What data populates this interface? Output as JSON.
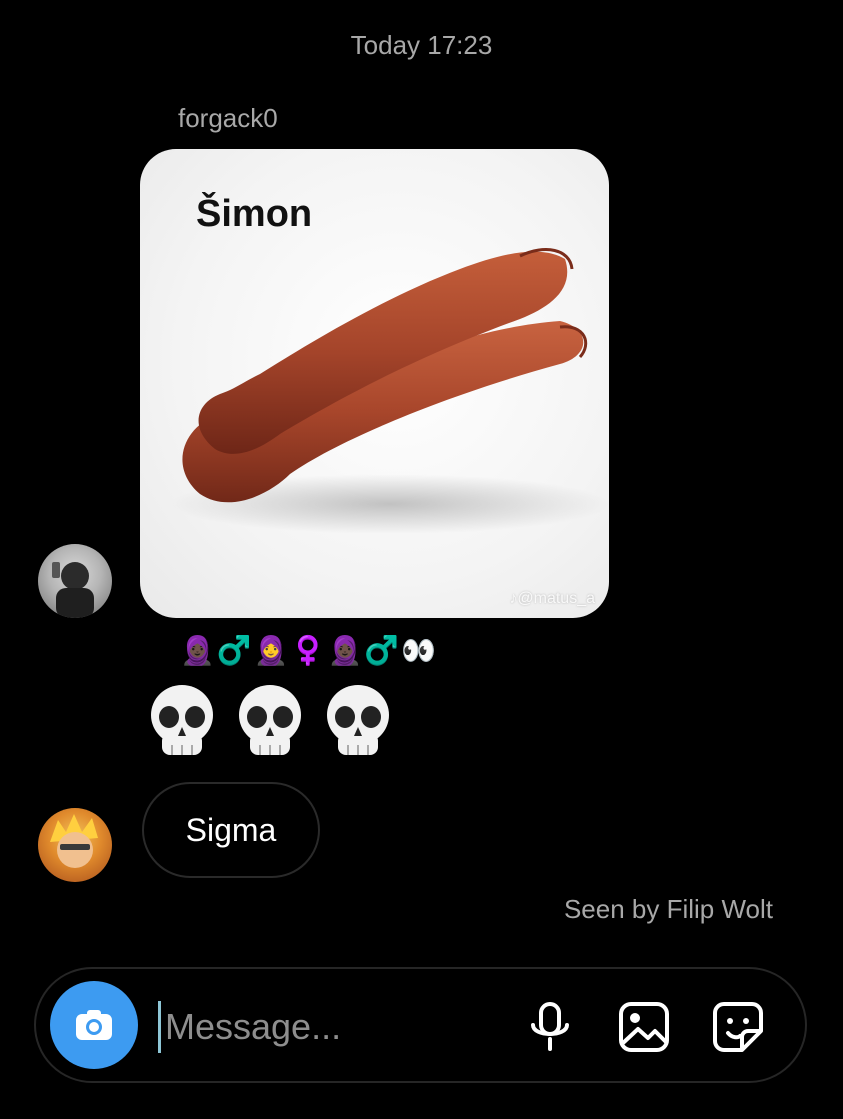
{
  "chat": {
    "timestamp": "Today 17:23",
    "sender": "forgack0",
    "image_caption": "Šimon",
    "image_watermark": "♪@matus_a",
    "emoji_reaction": "🧕🏿♂️🧕♀️🧕🏿♂️👀",
    "skull_icons": [
      "skull-icon",
      "skull-icon",
      "skull-icon"
    ],
    "text_message": "Sigma",
    "seen_text": "Seen by Filip Wolt"
  },
  "composer": {
    "placeholder": "Message...",
    "icons": {
      "camera": "camera-icon",
      "mic": "microphone-icon",
      "gallery": "image-icon",
      "sticker": "sticker-icon"
    }
  },
  "colors": {
    "background": "#000000",
    "muted_text": "#a8a8a8",
    "camera_button": "#3d9bf1",
    "sausage": "#a4442a"
  }
}
